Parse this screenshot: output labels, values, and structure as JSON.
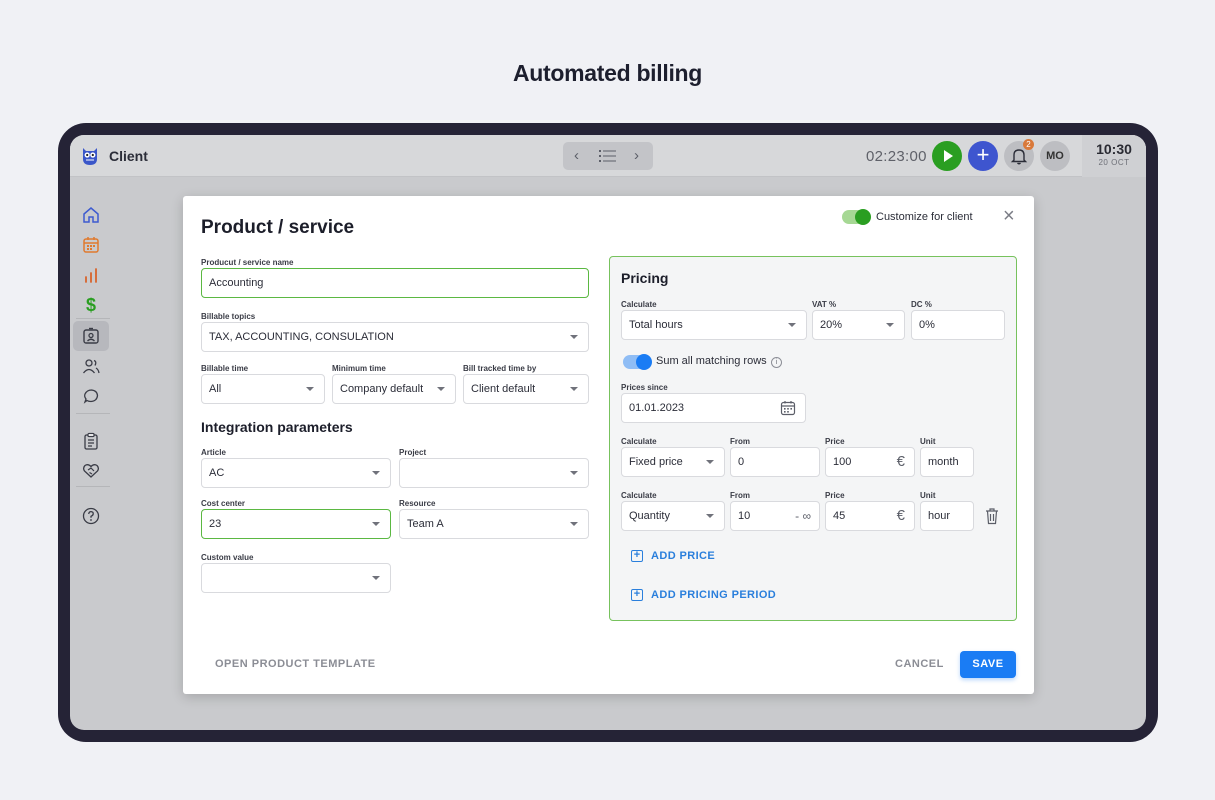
{
  "page": {
    "heading": "Automated billing"
  },
  "topbar": {
    "app_title": "Client",
    "timer": "02:23:00",
    "notification_count": "2",
    "avatar_initials": "MO",
    "clock_time": "10:30",
    "clock_date": "20 OCT",
    "icons": [
      "owl-logo-icon",
      "back-icon",
      "list-icon",
      "forward-icon",
      "play-icon",
      "plus-icon",
      "bell-icon"
    ]
  },
  "sidebar": {
    "items": [
      "home-icon",
      "calendar-icon",
      "chart-icon",
      "dollar-icon",
      "contact-card-icon",
      "users-icon",
      "chat-icon",
      "clipboard-icon",
      "handshake-icon",
      "help-icon"
    ],
    "active_item": "contact-card-icon"
  },
  "modal": {
    "title": "Product / service",
    "customize_label": "Customize for client",
    "customize_enabled": true,
    "name_label": "Producut / service name",
    "name_value": "Accounting",
    "billable_topics_label": "Billable topics",
    "billable_topics_value": "TAX, ACCOUNTING, CONSULATION",
    "billable_time_label": "Billable time",
    "billable_time_value": "All",
    "minimum_time_label": "Minimum time",
    "minimum_time_value": "Company default",
    "bill_tracked_label": "Bill tracked time by",
    "bill_tracked_value": "Client default",
    "integration_title": "Integration parameters",
    "article_label": "Article",
    "article_value": "AC",
    "project_label": "Project",
    "project_value": "",
    "cost_center_label": "Cost center",
    "cost_center_value": "23",
    "resource_label": "Resource",
    "resource_value": "Team A",
    "custom_value_label": "Custom value",
    "custom_value_value": "",
    "open_template": "OPEN PRODUCT TEMPLATE",
    "cancel": "CANCEL",
    "save": "SAVE"
  },
  "pricing": {
    "title": "Pricing",
    "calculate_label": "Calculate",
    "calculate_value": "Total hours",
    "vat_label": "VAT %",
    "vat_value": "20%",
    "dc_label": "DC %",
    "dc_value": "0%",
    "sum_rows_label": "Sum all matching rows",
    "sum_rows_enabled": true,
    "prices_since_label": "Prices since",
    "prices_since_value": "01.01.2023",
    "rows": [
      {
        "calc_label": "Calculate",
        "calc": "Fixed price",
        "from_label": "From",
        "from": "0",
        "to": "",
        "price_label": "Price",
        "price": "100",
        "currency": "€",
        "unit_label": "Unit",
        "unit": "month"
      },
      {
        "calc_label": "Calculate",
        "calc": "Quantity",
        "from_label": "From",
        "from": "10",
        "to": "- ∞",
        "price_label": "Price",
        "price": "45",
        "currency": "€",
        "unit_label": "Unit",
        "unit": "hour"
      }
    ],
    "add_price": "ADD PRICE",
    "add_pricing_period": "ADD PRICING PERIOD"
  },
  "colors": {
    "accent_green": "#2a9e21",
    "primary_blue": "#1a7cf4",
    "focus_green": "#5bb842"
  }
}
